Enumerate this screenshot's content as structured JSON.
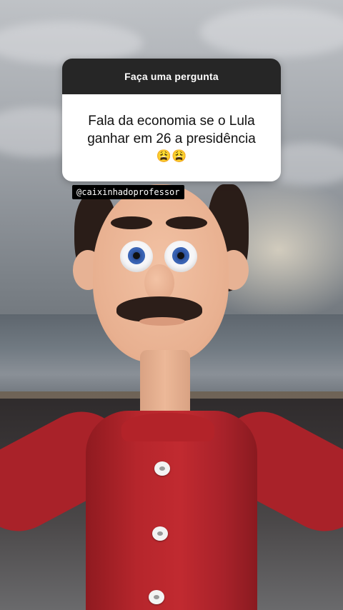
{
  "sticker": {
    "header": "Faça uma pergunta",
    "question_line1": "Fala da economia se o Lula",
    "question_line2": "ganhar em 26 a presidência",
    "emojis": "😩😩"
  },
  "handle": "@caixinhadoprofessor",
  "colors": {
    "sticker_header_bg": "#262626",
    "sticker_body_bg": "#ffffff",
    "shirt_red": "#b6262c",
    "handle_bg": "#000000"
  }
}
